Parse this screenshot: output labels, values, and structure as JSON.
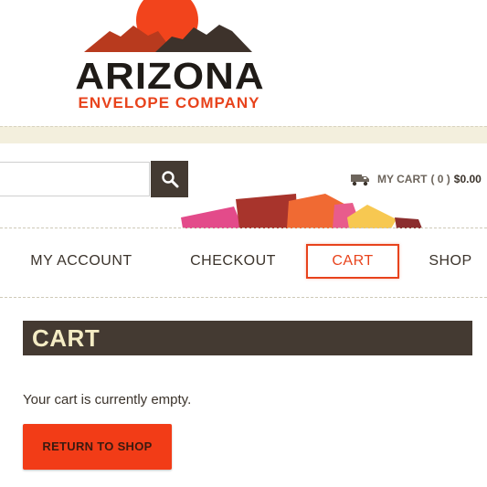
{
  "brand": {
    "name": "ARIZONA",
    "subtitle": "ENVELOPE COMPANY",
    "colors": {
      "sun": "#f2441c",
      "mountain_red": "#b83a1e",
      "mountain_dark": "#3d322b",
      "accent": "#e8431c"
    }
  },
  "header": {
    "search": {
      "value": "",
      "placeholder": "",
      "icon": "search-icon"
    },
    "mini_cart": {
      "label": "MY CART",
      "count": "( 0 )",
      "total": "$0.00",
      "icon": "truck-icon"
    }
  },
  "nav": {
    "items": [
      {
        "label": "MY ACCOUNT",
        "active": false
      },
      {
        "label": "CHECKOUT",
        "active": false
      },
      {
        "label": "CART",
        "active": true
      },
      {
        "label": "SHOP",
        "active": false
      }
    ]
  },
  "page": {
    "title": "CART",
    "empty_message": "Your cart is currently empty.",
    "return_button": "RETURN TO SHOP"
  }
}
